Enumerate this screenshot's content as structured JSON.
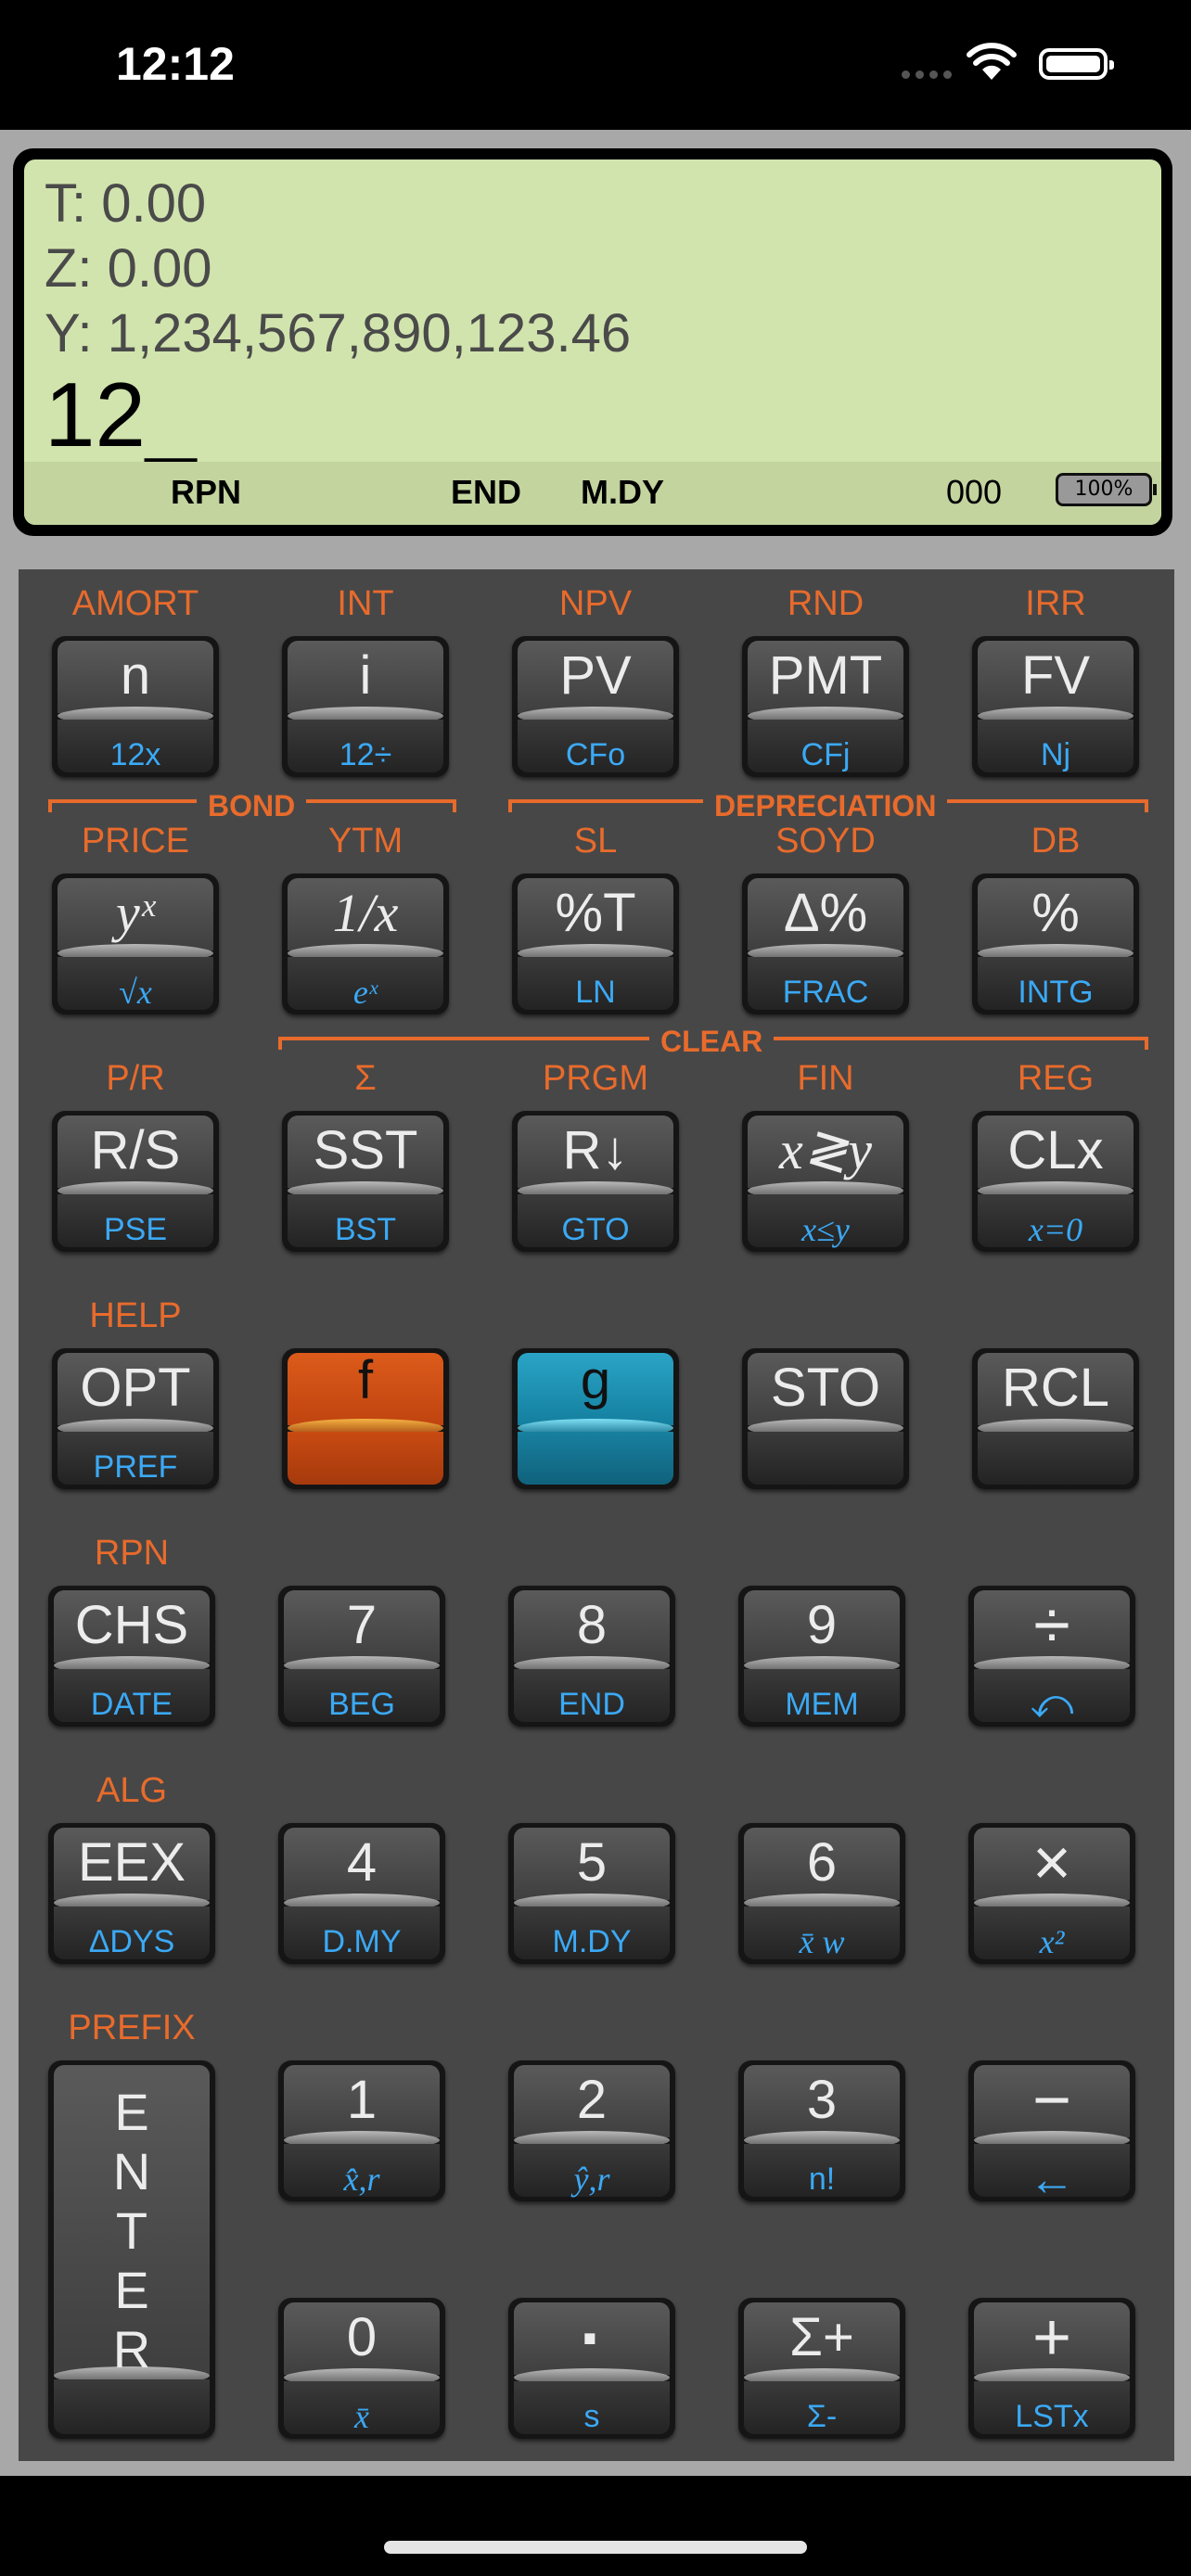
{
  "status_bar": {
    "time": "12:12"
  },
  "display": {
    "t": "T:  0.00",
    "z": "Z:  0.00",
    "y": "Y:  1,234,567,890,123.46",
    "x": "12_",
    "indicators": {
      "mode": "RPN",
      "payment": "END",
      "date_format": "M.DY",
      "program_step": "000",
      "battery": "100%"
    }
  },
  "brackets": {
    "bond": "BOND",
    "depreciation": "DEPRECIATION",
    "clear": "CLEAR"
  },
  "keys": {
    "n": {
      "f": "AMORT",
      "main": "n",
      "g": "12x"
    },
    "i": {
      "f": "INT",
      "main": "i",
      "g": "12÷"
    },
    "pv": {
      "f": "NPV",
      "main": "PV",
      "g": "CFo"
    },
    "pmt": {
      "f": "RND",
      "main": "PMT",
      "g": "CFj"
    },
    "fv": {
      "f": "IRR",
      "main": "FV",
      "g": "Nj"
    },
    "yx": {
      "f": "PRICE",
      "main": "yˣ",
      "g": "√x"
    },
    "inv": {
      "f": "YTM",
      "main": "1/x",
      "g": "eˣ"
    },
    "pct_t": {
      "f": "SL",
      "main": "%T",
      "g": "LN"
    },
    "dpct": {
      "f": "SOYD",
      "main": "Δ%",
      "g": "FRAC"
    },
    "pct": {
      "f": "DB",
      "main": "%",
      "g": "INTG"
    },
    "rs": {
      "f": "P/R",
      "main": "R/S",
      "g": "PSE"
    },
    "sst": {
      "f": "Σ",
      "main": "SST",
      "g": "BST"
    },
    "rdn": {
      "f": "PRGM",
      "main": "R↓",
      "g": "GTO"
    },
    "xy": {
      "f": "FIN",
      "main": "x≷y",
      "g": "x≤y"
    },
    "clx": {
      "f": "REG",
      "main": "CLx",
      "g": "x=0"
    },
    "opt": {
      "f": "HELP",
      "main": "OPT",
      "g": "PREF"
    },
    "fkey": {
      "main": "f"
    },
    "gkey": {
      "main": "g"
    },
    "sto": {
      "main": "STO"
    },
    "rcl": {
      "main": "RCL"
    },
    "chs": {
      "f": "RPN",
      "main": "CHS",
      "g": "DATE"
    },
    "k7": {
      "main": "7",
      "g": "BEG"
    },
    "k8": {
      "main": "8",
      "g": "END"
    },
    "k9": {
      "main": "9",
      "g": "MEM"
    },
    "div": {
      "main": "÷",
      "g": "⤺"
    },
    "eex": {
      "f": "ALG",
      "main": "EEX",
      "g": "ΔDYS"
    },
    "k4": {
      "main": "4",
      "g": "D.MY"
    },
    "k5": {
      "main": "5",
      "g": "M.DY"
    },
    "k6": {
      "main": "6",
      "g": "x̄ w"
    },
    "mul": {
      "main": "×",
      "g": "x²"
    },
    "enter": {
      "f": "PREFIX",
      "main": "ENTER"
    },
    "k1": {
      "main": "1",
      "g": "x̂,r"
    },
    "k2": {
      "main": "2",
      "g": "ŷ,r"
    },
    "k3": {
      "main": "3",
      "g": "n!"
    },
    "sub": {
      "main": "−",
      "g": "←"
    },
    "k0": {
      "main": "0",
      "g": "x̄"
    },
    "dot": {
      "main": "·",
      "g": "s"
    },
    "sigma": {
      "main": "Σ+",
      "g": "Σ-"
    },
    "add": {
      "main": "+",
      "g": "LSTx"
    }
  }
}
